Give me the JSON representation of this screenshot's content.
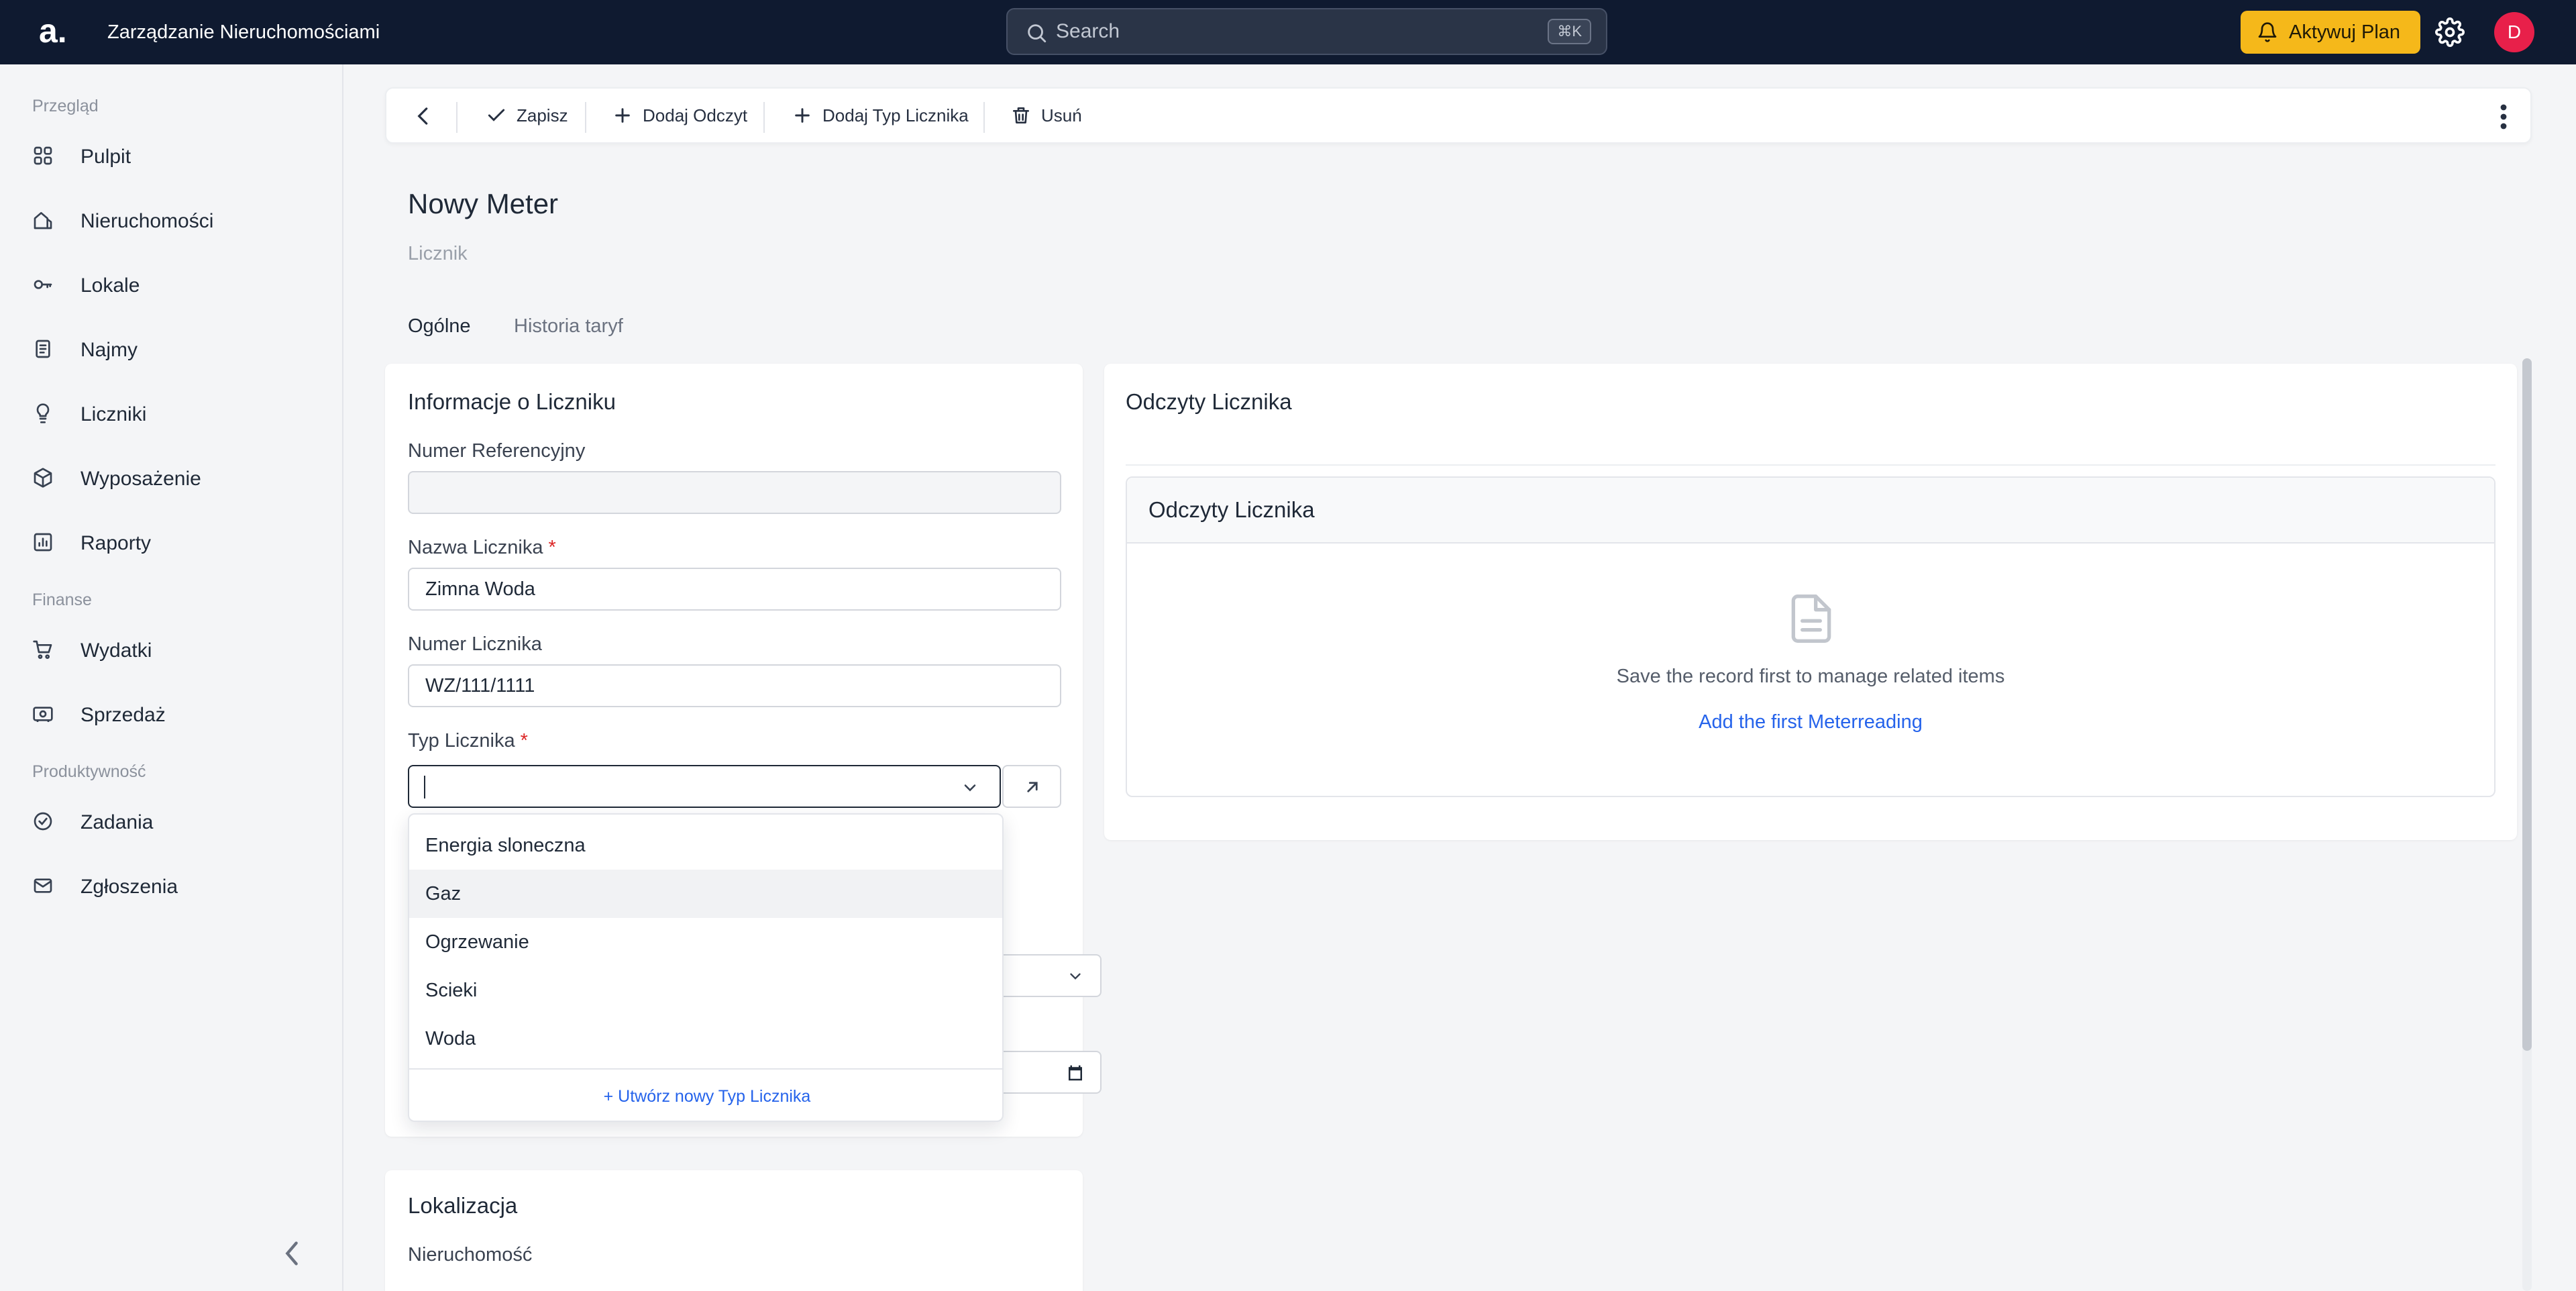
{
  "topbar": {
    "logo": "a.",
    "app_title": "Zarządzanie Nieruchomościami",
    "search_placeholder": "Search",
    "search_shortcut": "⌘K",
    "plan_button": "Aktywuj Plan",
    "avatar_initial": "D"
  },
  "sidebar": {
    "sections": [
      {
        "title": "Przegląd",
        "items": [
          {
            "label": "Pulpit",
            "icon": "grid-icon"
          },
          {
            "label": "Nieruchomości",
            "icon": "building-icon"
          },
          {
            "label": "Lokale",
            "icon": "key-icon"
          },
          {
            "label": "Najmy",
            "icon": "document-icon"
          },
          {
            "label": "Liczniki",
            "icon": "bulb-icon"
          },
          {
            "label": "Wyposażenie",
            "icon": "box-icon"
          },
          {
            "label": "Raporty",
            "icon": "chart-icon"
          }
        ]
      },
      {
        "title": "Finanse",
        "items": [
          {
            "label": "Wydatki",
            "icon": "cart-icon"
          },
          {
            "label": "Sprzedaż",
            "icon": "money-icon"
          }
        ]
      },
      {
        "title": "Produktywność",
        "items": [
          {
            "label": "Zadania",
            "icon": "check-circle-icon"
          },
          {
            "label": "Zgłoszenia",
            "icon": "mail-icon"
          }
        ]
      }
    ]
  },
  "toolbar": {
    "save": "Zapisz",
    "add_reading": "Dodaj Odczyt",
    "add_meter_type": "Dodaj Typ Licznika",
    "delete": "Usuń"
  },
  "page": {
    "title": "Nowy Meter",
    "subtitle": "Licznik",
    "tabs": [
      "Ogólne",
      "Historia taryf"
    ]
  },
  "form": {
    "card_title": "Informacje o Liczniku",
    "reference_label": "Numer Referencyjny",
    "reference_value": "",
    "name_label": "Nazwa Licznika",
    "name_value": "Zimna Woda",
    "number_label": "Numer Licznika",
    "number_value": "WZ/111/1111",
    "type_label": "Typ Licznika",
    "required_mark": "*"
  },
  "dropdown": {
    "options": [
      "Energia sloneczna",
      "Gaz",
      "Ogrzewanie",
      "Scieki",
      "Woda"
    ],
    "highlighted": "Gaz",
    "create_label": "+ Utwórz nowy Typ Licznika"
  },
  "location": {
    "card_title": "Lokalizacja",
    "property_label": "Nieruchomość"
  },
  "readings": {
    "card_title": "Odczyty Licznika",
    "sub_title": "Odczyty Licznika",
    "empty_text": "Save the record first to manage related items",
    "empty_link": "Add the first Meterreading"
  },
  "colors": {
    "topbar_bg": "#0f1a30",
    "accent": "#f5b81a",
    "avatar": "#e8204a",
    "link": "#2563eb",
    "required": "#dc2626"
  }
}
